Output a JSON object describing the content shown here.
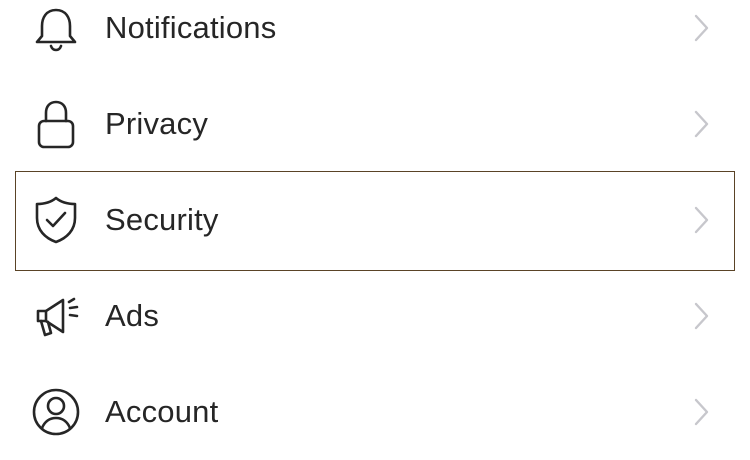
{
  "settings_list": {
    "items": [
      {
        "label": "Notifications",
        "icon": "bell-icon"
      },
      {
        "label": "Privacy",
        "icon": "lock-icon"
      },
      {
        "label": "Security",
        "icon": "shield-check-icon"
      },
      {
        "label": "Ads",
        "icon": "megaphone-icon"
      },
      {
        "label": "Account",
        "icon": "user-circle-icon"
      }
    ],
    "selected_item": "Security",
    "chevron_icon": "chevron-right-icon"
  },
  "colors": {
    "text": "#262626",
    "icon": "#262626",
    "chevron": "#c7c7cc",
    "focus_border": "#5a4326",
    "background": "#ffffff"
  }
}
